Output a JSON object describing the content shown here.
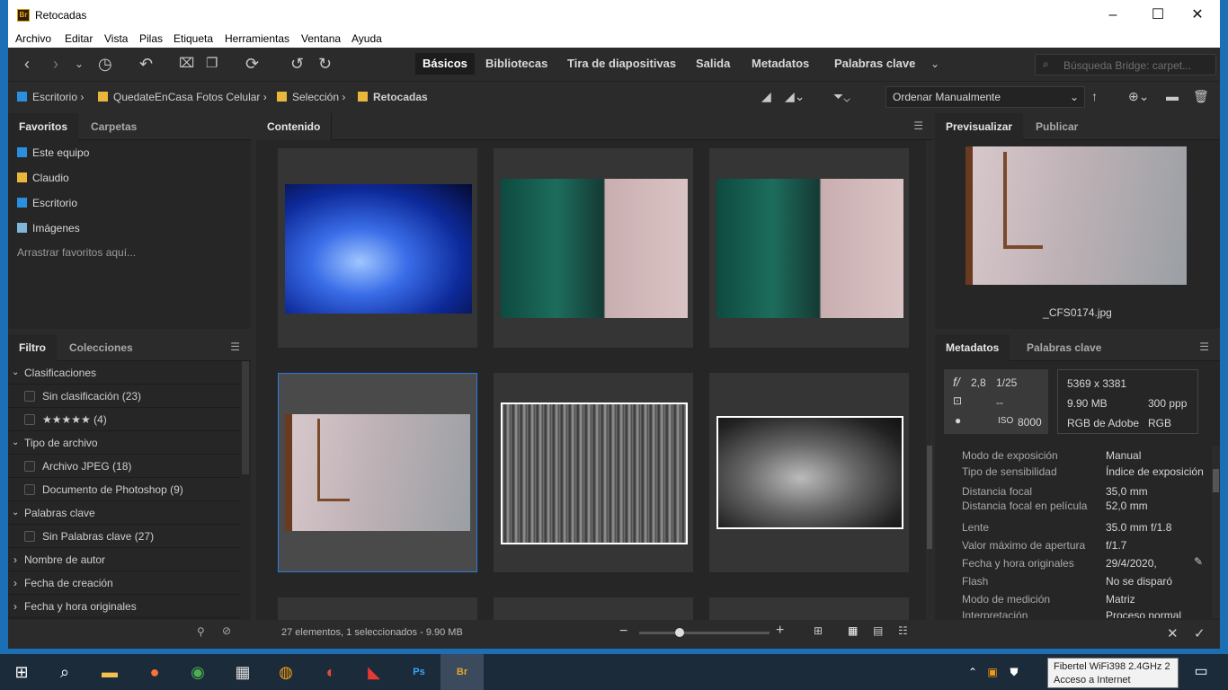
{
  "app": {
    "title": "Retocadas",
    "logo": "Br"
  },
  "menu": [
    "Archivo",
    "Editar",
    "Vista",
    "Pilas",
    "Etiqueta",
    "Herramientas",
    "Ventana",
    "Ayuda"
  ],
  "workspaces": [
    "Básicos",
    "Bibliotecas",
    "Tira de diapositivas",
    "Salida",
    "Metadatos",
    "Palabras clave"
  ],
  "search": {
    "placeholder": "Búsqueda Bridge: carpet..."
  },
  "breadcrumb": [
    "Escritorio",
    "QuedateEnCasa Fotos Celular",
    "Selección",
    "Retocadas"
  ],
  "sort": {
    "label": "Ordenar Manualmente"
  },
  "left_tabs": [
    "Favoritos",
    "Carpetas"
  ],
  "favorites": [
    "Este equipo",
    "Claudio",
    "Escritorio",
    "Imágenes"
  ],
  "fav_hint": "Arrastrar favoritos aquí...",
  "filter_tabs": [
    "Filtro",
    "Colecciones"
  ],
  "filter": {
    "sec1": "Clasificaciones",
    "sec1_items": [
      "Sin clasificación (23)",
      "★★★★★ (4)"
    ],
    "sec2": "Tipo de archivo",
    "sec2_items": [
      "Archivo JPEG (18)",
      "Documento de Photoshop (9)"
    ],
    "sec3": "Palabras clave",
    "sec3_items": [
      "Sin Palabras clave (27)"
    ],
    "sec4": "Nombre de autor",
    "sec5": "Fecha de creación",
    "sec6": "Fecha y hora originales"
  },
  "content": {
    "tab": "Contenido",
    "status": "27 elementos, 1 seleccionados - 9.90 MB"
  },
  "preview": {
    "tabs": [
      "Previsualizar",
      "Publicar"
    ],
    "filename": "_CFS0174.jpg"
  },
  "meta_tabs": [
    "Metadatos",
    "Palabras clave"
  ],
  "camera": {
    "fstop": "2,8",
    "shutter": "1/25",
    "exp": "--",
    "iso": "8000",
    "dims": "5369 x 3381",
    "size": "9.90 MB",
    "ppi": "300 ppp",
    "profile": "RGB de Adobe",
    "mode": "RGB"
  },
  "exif": [
    {
      "k": "Modo de exposición",
      "v": "Manual"
    },
    {
      "k": "Tipo de sensibilidad",
      "v": "Índice de exposición"
    },
    {
      "k": "Distancia focal",
      "v": "35,0 mm"
    },
    {
      "k": "Distancia focal en película",
      "v": "52,0 mm"
    },
    {
      "k": "Lente",
      "v": "35.0 mm f/1.8"
    },
    {
      "k": "Valor máximo de apertura",
      "v": "f/1.7"
    },
    {
      "k": "Fecha y hora originales",
      "v": "29/4/2020,"
    },
    {
      "k": "Flash",
      "v": "No se disparó"
    },
    {
      "k": "Modo de medición",
      "v": "Matriz"
    },
    {
      "k": "Interpretación",
      "v": "Proceso normal"
    }
  ],
  "tooltip": [
    "Fibertel WiFi398 2.4GHz 2",
    "Acceso a Internet"
  ],
  "colors": {
    "accent": "#2a7be0",
    "panel": "#262626",
    "folder": "#e9b73c"
  }
}
